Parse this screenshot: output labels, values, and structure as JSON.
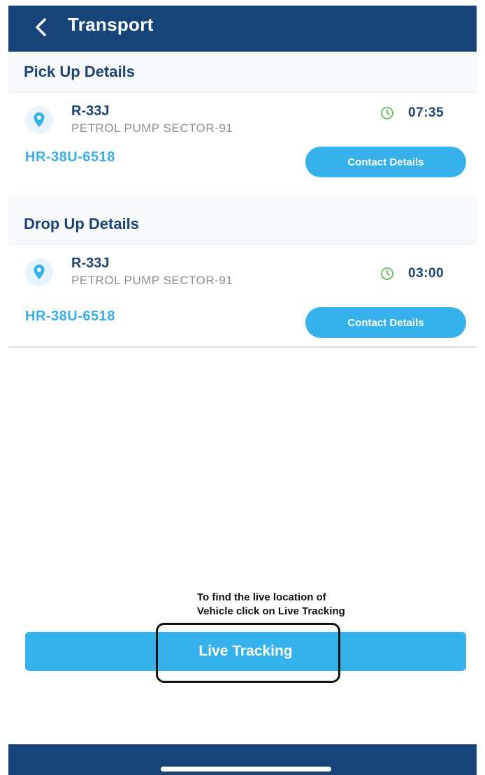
{
  "header": {
    "title": "Transport"
  },
  "pickup": {
    "section_title": "Pick Up Details",
    "stop_code": "R-33J",
    "stop_name": "PETROL PUMP SECTOR-91",
    "time": "07:35",
    "vehicle_number": "HR-38U-6518",
    "contact_label": "Contact Details"
  },
  "drop": {
    "section_title": "Drop Up Details",
    "stop_code": "R-33J",
    "stop_name": "PETROL PUMP SECTOR-91",
    "time": "03:00",
    "vehicle_number": "HR-38U-6518",
    "contact_label": "Contact Details"
  },
  "annotation": {
    "line1": "To find the live location of",
    "line2": "Vehicle click on Live Tracking"
  },
  "live_tracking": {
    "label": "Live Tracking"
  },
  "colors": {
    "header": "#17457a",
    "accent": "#35b1ec",
    "clock": "#6cc16a",
    "text_dark": "#1b4472"
  },
  "icons": {
    "back": "chevron-left-icon",
    "location": "location-pin-icon",
    "time": "clock-icon"
  }
}
